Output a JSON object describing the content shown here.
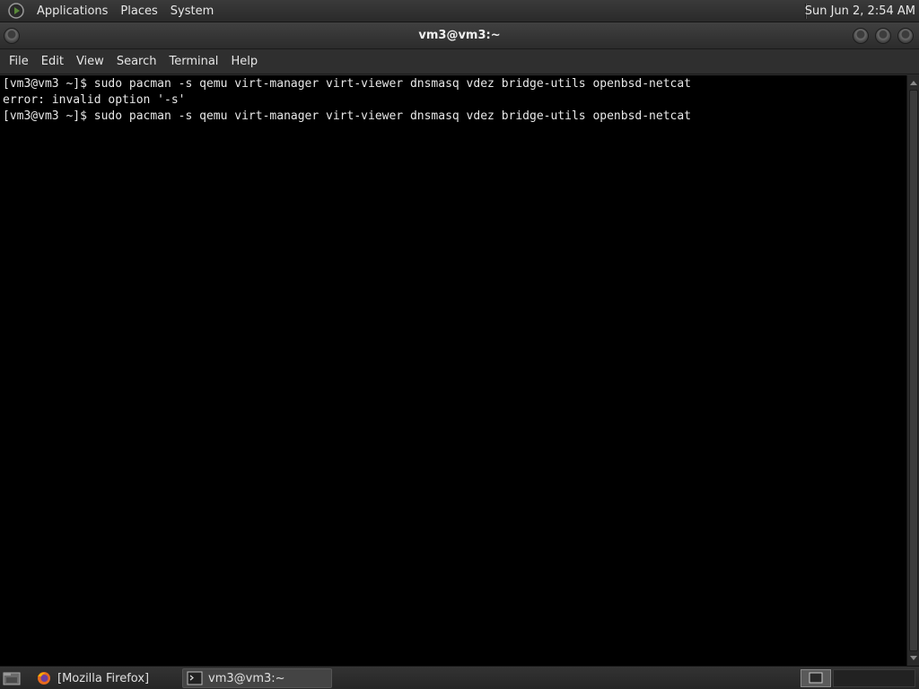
{
  "top_panel": {
    "menus": [
      "Applications",
      "Places",
      "System"
    ],
    "clock": "Sun Jun  2,  2:54 AM",
    "logo_icon": "gnome-foot-icon"
  },
  "window": {
    "title": "vm3@vm3:~",
    "menus": [
      "File",
      "Edit",
      "View",
      "Search",
      "Terminal",
      "Help"
    ]
  },
  "terminal": {
    "lines": [
      "[vm3@vm3 ~]$ sudo pacman -s qemu virt-manager virt-viewer dnsmasq vdez bridge-utils openbsd-netcat",
      "error: invalid option '-s'",
      "[vm3@vm3 ~]$ sudo pacman -s qemu virt-manager virt-viewer dnsmasq vdez bridge-utils openbsd-netcat"
    ],
    "background": "#000000",
    "foreground": "#e8e8e8"
  },
  "taskbar": {
    "tasks": [
      {
        "label": "[Mozilla Firefox]",
        "icon": "firefox-icon"
      },
      {
        "label": "vm3@vm3:~",
        "icon": "terminal-icon"
      }
    ]
  }
}
